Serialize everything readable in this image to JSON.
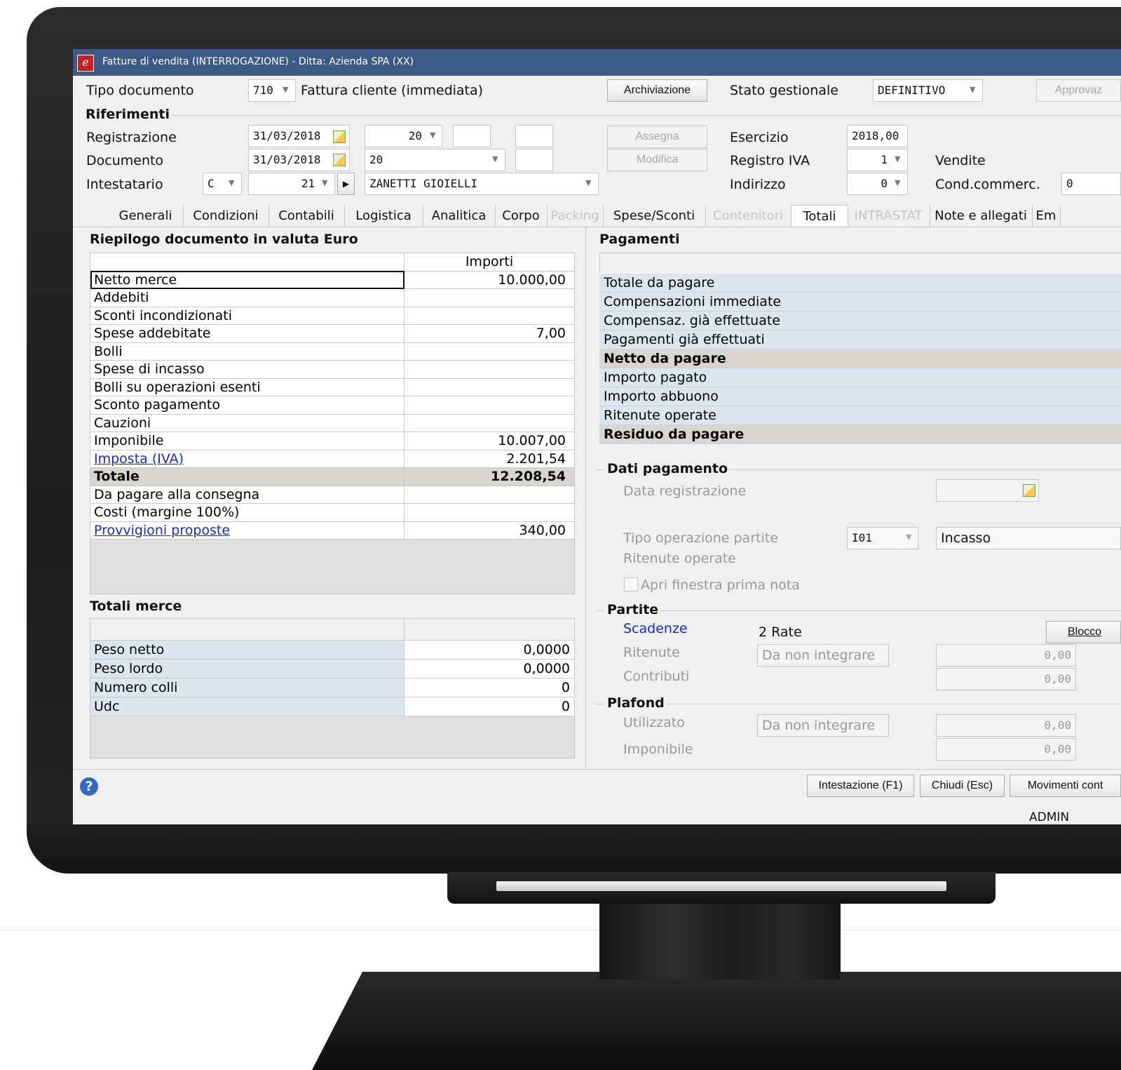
{
  "window": {
    "title": "Fatture di vendita (INTERROGAZIONE)  - Ditta: Azienda SPA (XX)",
    "user": "ADMIN"
  },
  "header": {
    "tipo_documento_label": "Tipo documento",
    "tipo_documento_code": "710",
    "tipo_documento_desc": "Fattura cliente (immediata)",
    "archiviazione_button": "Archiviazione",
    "stato_gestionale_label": "Stato gestionale",
    "stato_gestionale_value": "DEFINITIVO",
    "approvaz_button": "Approvaz",
    "riferimenti_label": "Riferimenti",
    "registrazione_label": "Registrazione",
    "registrazione_date": "31/03/2018",
    "registrazione_number": "20",
    "documento_label": "Documento",
    "documento_date": "31/03/2018",
    "documento_number": "20",
    "intestatario_label": "Intestatario",
    "intestatario_type": "C",
    "intestatario_code": "21",
    "intestatario_name": "ZANETTI GIOIELLI",
    "assegna_button": "Assegna",
    "modifica_button": "Modifica",
    "esercizio_label": "Esercizio",
    "esercizio_value": "2018,00",
    "registro_iva_label": "Registro IVA",
    "registro_iva_value": "1",
    "registro_iva_desc": "Vendite",
    "indirizzo_label": "Indirizzo",
    "indirizzo_value": "0",
    "cond_commerc_label": "Cond.commerc.",
    "cond_commerc_value": "0"
  },
  "tabs": [
    {
      "label": "Generali",
      "state": "normal"
    },
    {
      "label": "Condizioni",
      "state": "normal"
    },
    {
      "label": "Contabili",
      "state": "normal"
    },
    {
      "label": "Logistica",
      "state": "normal"
    },
    {
      "label": "Analitica",
      "state": "normal"
    },
    {
      "label": "Corpo",
      "state": "normal"
    },
    {
      "label": "Packing",
      "state": "disabled"
    },
    {
      "label": "Spese/Sconti",
      "state": "normal"
    },
    {
      "label": "Contenitori",
      "state": "disabled"
    },
    {
      "label": "Totali",
      "state": "active"
    },
    {
      "label": "INTRASTAT",
      "state": "disabled"
    },
    {
      "label": "Note e allegati",
      "state": "normal"
    },
    {
      "label": "Em",
      "state": "normal"
    }
  ],
  "riepilogo": {
    "title": "Riepilogo documento in valuta Euro",
    "column_header": "Importi",
    "rows": [
      {
        "label": "Netto merce",
        "value": "10.000,00"
      },
      {
        "label": "Addebiti",
        "value": ""
      },
      {
        "label": "Sconti incondizionati",
        "value": ""
      },
      {
        "label": "Spese addebitate",
        "value": "7,00"
      },
      {
        "label": "Bolli",
        "value": ""
      },
      {
        "label": "Spese di incasso",
        "value": ""
      },
      {
        "label": "Bolli su operazioni esenti",
        "value": ""
      },
      {
        "label": "Sconto pagamento",
        "value": ""
      },
      {
        "label": "Cauzioni",
        "value": ""
      },
      {
        "label": "Imponibile",
        "value": "10.007,00"
      },
      {
        "label": "Imposta (IVA)",
        "value": "2.201,54"
      },
      {
        "label": "Totale",
        "value": "12.208,54"
      },
      {
        "label": "Da pagare alla consegna",
        "value": ""
      },
      {
        "label": "Costi (margine 100%)",
        "value": ""
      },
      {
        "label": "Provvigioni proposte",
        "value": "340,00"
      }
    ]
  },
  "totali_merce": {
    "title": "Totali merce",
    "rows": [
      {
        "label": "Peso netto",
        "value": "0,0000"
      },
      {
        "label": "Peso lordo",
        "value": "0,0000"
      },
      {
        "label": "Numero colli",
        "value": "0"
      },
      {
        "label": "Udc",
        "value": "0"
      }
    ]
  },
  "pagamenti": {
    "title": "Pagamenti",
    "rows": [
      "Totale da pagare",
      "Compensazioni immediate",
      "Compensaz. già effettuate",
      "Pagamenti già effettuati",
      "Netto da pagare",
      "Importo pagato",
      "Importo abbuono",
      "Ritenute operate",
      "Residuo da pagare"
    ]
  },
  "dati_pagamento": {
    "title": "Dati pagamento",
    "data_registrazione_label": "Data registrazione",
    "tipo_operazione_label": "Tipo operazione partite",
    "tipo_operazione_code": "I01",
    "tipo_operazione_desc": "Incasso",
    "ritenute_operate_label": "Ritenute operate",
    "apri_finestra_label": "Apri finestra prima nota"
  },
  "partite": {
    "title": "Partite",
    "scadenze_label": "Scadenze",
    "scadenze_value": "2 Rate",
    "blocco_button": "Blocco",
    "ritenute_label": "Ritenute",
    "ritenute_mode": "Da non integrare",
    "ritenute_value": "0,00",
    "contributi_label": "Contributi",
    "contributi_value": "0,00"
  },
  "plafond": {
    "title": "Plafond",
    "utilizzato_label": "Utilizzato",
    "utilizzato_mode": "Da non integrare",
    "utilizzato_value": "0,00",
    "imponibile_label": "Imponibile",
    "imponibile_value": "0,00"
  },
  "footer": {
    "intestazione_button": "Intestazione (F1)",
    "chiudi_button": "Chiudi (Esc)",
    "movimenti_button": "Movimenti cont"
  },
  "colors": {
    "titlebar": "#3b5a87",
    "row_blue": "#dde6f0",
    "row_total": "#d9d6cf",
    "link": "#1a28c8"
  }
}
